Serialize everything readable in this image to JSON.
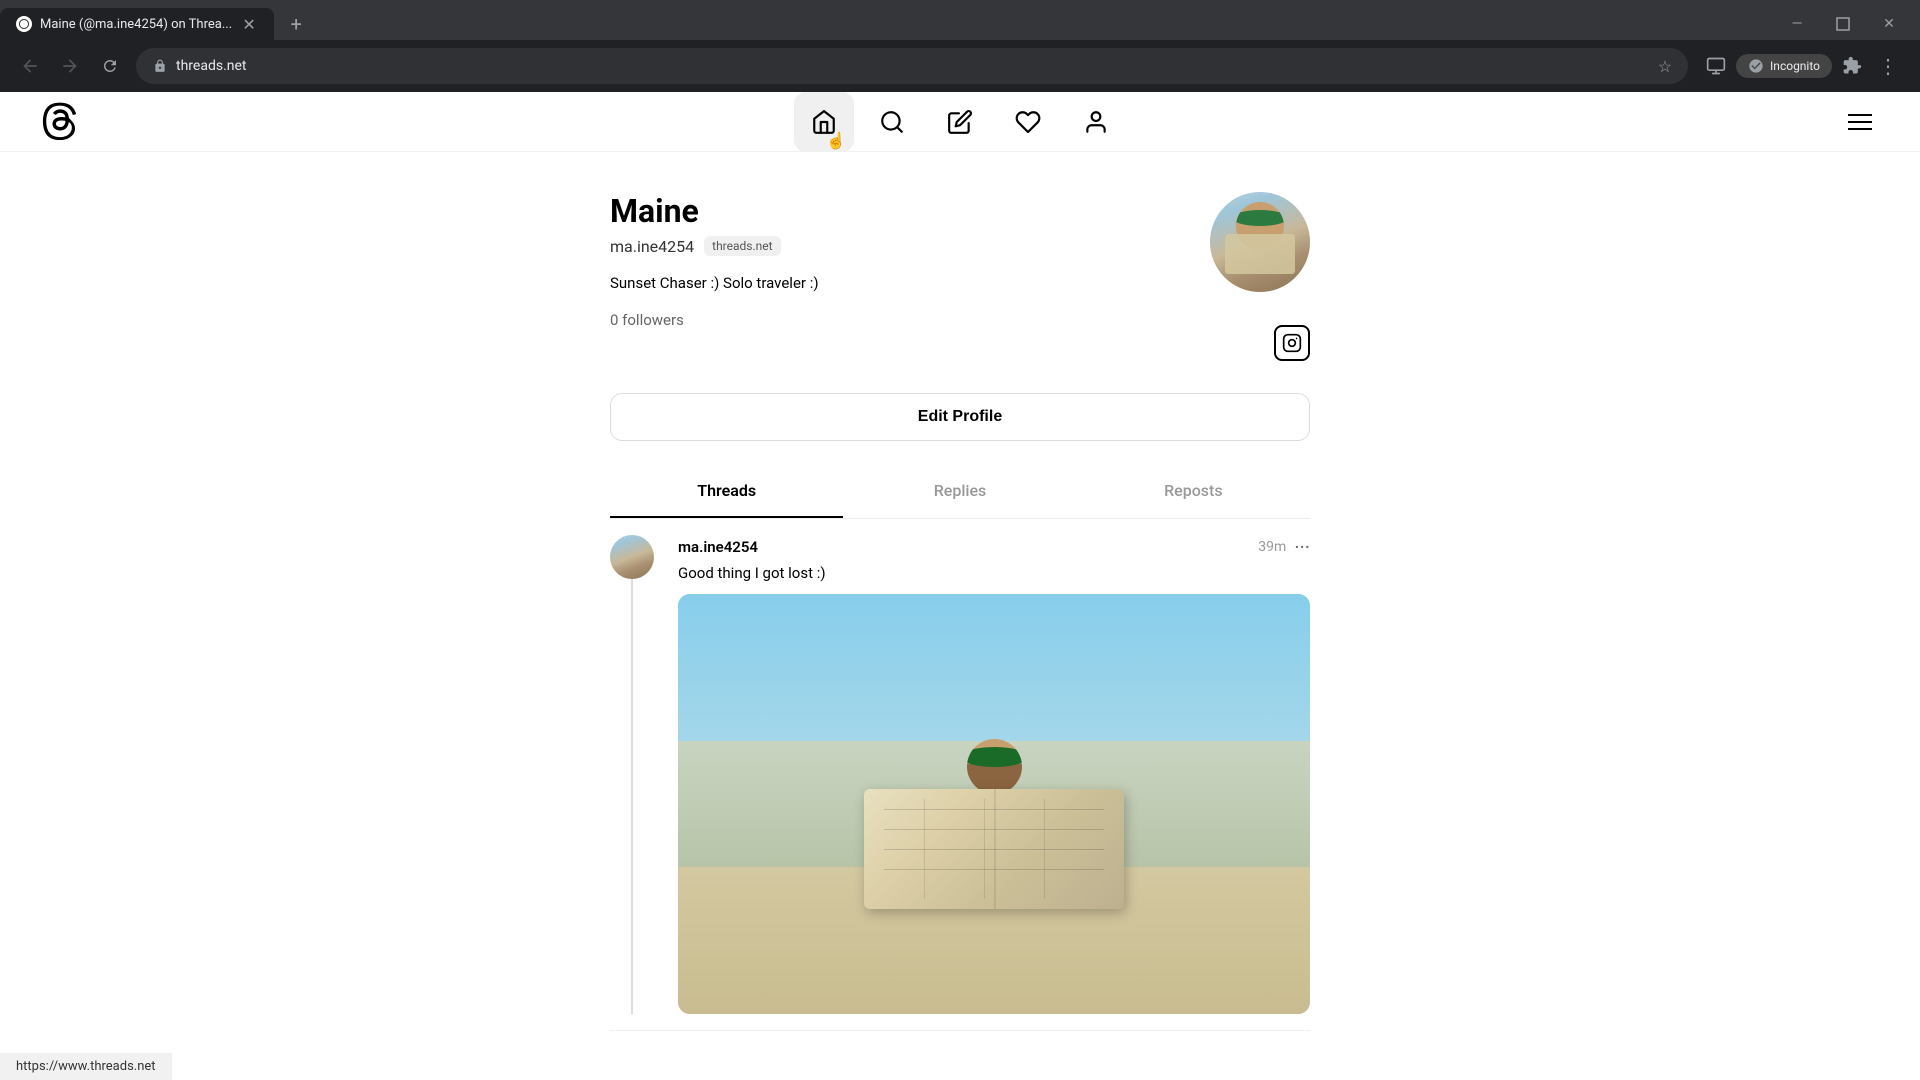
{
  "browser": {
    "tab_title": "Maine (@ma.ine4254) on Threa...",
    "tab_favicon": "T",
    "url": "threads.net",
    "incognito_label": "Incognito",
    "status_bar_url": "https://www.threads.net"
  },
  "nav": {
    "logo_alt": "Threads logo",
    "items": [
      {
        "id": "home",
        "label": "Home",
        "active": true
      },
      {
        "id": "search",
        "label": "Search",
        "active": false
      },
      {
        "id": "compose",
        "label": "New Thread",
        "active": false
      },
      {
        "id": "activity",
        "label": "Activity",
        "active": false
      },
      {
        "id": "profile",
        "label": "Profile",
        "active": false
      }
    ]
  },
  "profile": {
    "name": "Maine",
    "handle": "ma.ine4254",
    "badge": "threads.net",
    "bio": "Sunset Chaser :) Solo traveler :)",
    "followers": "0 followers",
    "edit_profile_label": "Edit Profile",
    "instagram_icon": "⊙"
  },
  "tabs": [
    {
      "label": "Threads",
      "active": true
    },
    {
      "label": "Replies",
      "active": false
    },
    {
      "label": "Reposts",
      "active": false
    }
  ],
  "posts": [
    {
      "username": "ma.ine4254",
      "time": "39m",
      "text": "Good thing I got lost :)"
    }
  ],
  "window_controls": {
    "minimize": "—",
    "maximize": "❐",
    "close": "✕"
  }
}
